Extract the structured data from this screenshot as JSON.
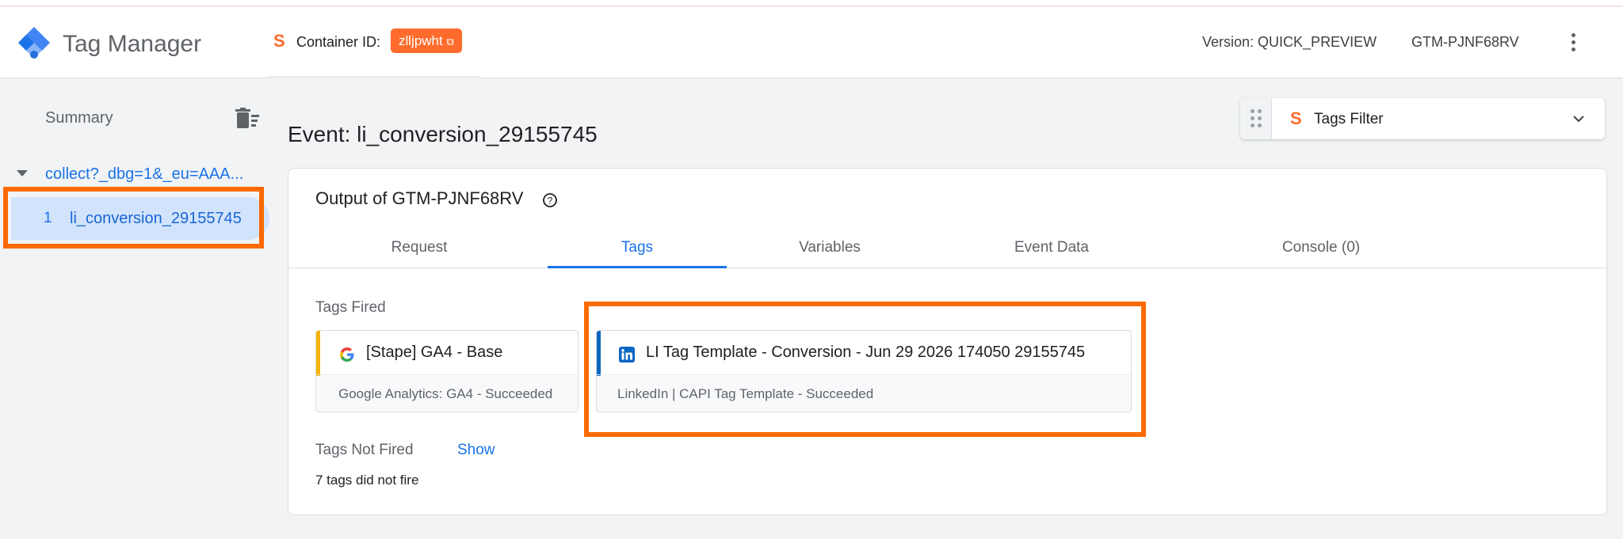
{
  "header": {
    "app_title": "Tag Manager",
    "container_label": "Container ID:",
    "container_id": "zlljpwht",
    "version": "Version: QUICK_PREVIEW",
    "gtm_id": "GTM-PJNF68RV"
  },
  "sidebar": {
    "summary": "Summary",
    "request": "collect?_dbg=1&_eu=AAA...",
    "event_number": "1",
    "event_name": "li_conversion_29155745"
  },
  "main": {
    "event_title": "Event: li_conversion_29155745",
    "filter_label": "Tags Filter",
    "output_title": "Output of GTM-PJNF68RV",
    "tabs": [
      {
        "label": "Request"
      },
      {
        "label": "Tags"
      },
      {
        "label": "Variables"
      },
      {
        "label": "Event Data"
      },
      {
        "label": "Console (0)"
      }
    ],
    "active_tab": "Tags",
    "tags_fired_label": "Tags Fired",
    "tags_fired": [
      {
        "name": "[Stape] GA4 - Base",
        "status": "Google Analytics: GA4 - Succeeded",
        "icon": "google-icon",
        "accent": "#f4b400"
      },
      {
        "name": "LI Tag Template - Conversion - Jun 29 2026 174050 29155745",
        "status": "LinkedIn | CAPI Tag Template - Succeeded",
        "icon": "linkedin-icon",
        "accent": "#0a66c2"
      }
    ],
    "tags_not_fired_label": "Tags Not Fired",
    "show_link": "Show",
    "not_fired_count": "7 tags did not fire"
  },
  "colors": {
    "highlight": "#ff6a00",
    "stape_orange": "#ff6b2c",
    "link_blue": "#1a73e8"
  }
}
